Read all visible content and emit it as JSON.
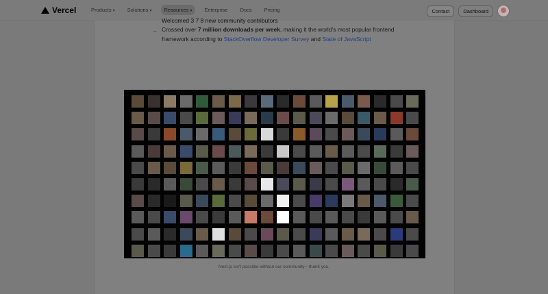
{
  "brand": {
    "name": "Vercel"
  },
  "nav": {
    "items": [
      {
        "label": "Products",
        "has_menu": true,
        "active": false
      },
      {
        "label": "Solutions",
        "has_menu": true,
        "active": false
      },
      {
        "label": "Resources",
        "has_menu": true,
        "active": true
      },
      {
        "label": "Enterprise",
        "has_menu": false,
        "active": false
      },
      {
        "label": "Docs",
        "has_menu": false,
        "active": false
      },
      {
        "label": "Pricing",
        "has_menu": false,
        "active": false
      }
    ],
    "contact_label": "Contact",
    "dashboard_label": "Dashboard"
  },
  "article": {
    "top_line": "Welcomed 3 7 8 new community contributors",
    "bullet_prefix": "Crossed over ",
    "bullet_bold": "7 million downloads per week",
    "bullet_mid": ", making it the world’s most popular frontend framework according to ",
    "link1": "StackOverflow Developer Survey",
    "and": " and ",
    "link2": "State of JavaScript"
  },
  "collage": {
    "tile_colors": [
      "#5a4a3a",
      "#3b3030",
      "#8a7a66",
      "#6b6b6b",
      "#2f5b3a",
      "#6a5a4a",
      "#7a6a4a",
      "#3a3a3a",
      "#5a6a7a",
      "#2a2a2a",
      "#6a4a3a",
      "#5a5a5a",
      "#b8a24a",
      "#4a5a6a",
      "#7a5a4a",
      "#2a2a2a",
      "#4a4a4a",
      "#6a6a5a",
      "#6a5a4a",
      "#5a4a4a",
      "#3a4a6a",
      "#4a4a4a",
      "#5a6a3a",
      "#6a5a5a",
      "#3a3a5a",
      "#7a6a5a",
      "#2a3a4a",
      "#6a4a4a",
      "#5a5a4a",
      "#4a4a5a",
      "#6a6a6a",
      "#5a4a3a",
      "#3a5a6a",
      "#6a5a4a",
      "#8a3a2a",
      "#4a4a4a",
      "#5a4a4a",
      "#3a3a3a",
      "#8a4a2a",
      "#4a5a6a",
      "#6a6a6a",
      "#3a5a7a",
      "#5a4a3a",
      "#6a6a3a",
      "#d8d8d8",
      "#3a3a3a",
      "#8a5a2a",
      "#5a4a5a",
      "#4a4a4a",
      "#6a5a5a",
      "#3a4a5a",
      "#2a3a5a",
      "#5a5a5a",
      "#6a4a3a",
      "#5a5a5a",
      "#4a3a3a",
      "#6a5a4a",
      "#3a4a6a",
      "#5a5a4a",
      "#6a4a4a",
      "#4a5a5a",
      "#7a6a5a",
      "#3a3a3a",
      "#c8c8c8",
      "#4a4a4a",
      "#5a5a5a",
      "#6a5a4a",
      "#5a5a5a",
      "#4a4a4a",
      "#5a6a5a",
      "#3a3a3a",
      "#6a5a5a",
      "#4a4a4a",
      "#6a5a4a",
      "#5a4a3a",
      "#7a6a3a",
      "#4a5a4a",
      "#5a5a5a",
      "#3a3a3a",
      "#6a4a3a",
      "#5a5a4a",
      "#4a3a3a",
      "#3a4a5a",
      "#6a5a5a",
      "#4a4a4a",
      "#5a5a4a",
      "#6a6a6a",
      "#3a4a3a",
      "#5a5a5a",
      "#4a4a4a",
      "#3a3a3a",
      "#2a2a2a",
      "#5a5a5a",
      "#3a4a3a",
      "#4a4a4a",
      "#6a5a4a",
      "#3a3a3a",
      "#5a4a4a",
      "#e8e8e8",
      "#4a4a5a",
      "#5a5a4a",
      "#3a3a4a",
      "#4a4a4a",
      "#7a5a7a",
      "#5a5a5a",
      "#4a4a4a",
      "#2a2a2a",
      "#4a5a4a",
      "#5a4a4a",
      "#2a2a2a",
      "#1a1a1a",
      "#5a5a4a",
      "#3a4a5a",
      "#5a6a3a",
      "#4a4a4a",
      "#5a4a3a",
      "#6a6a6a",
      "#f0f0f0",
      "#4a4a4a",
      "#4a3a6a",
      "#2a3a5a",
      "#7a7a7a",
      "#6a5a4a",
      "#4a5a6a",
      "#3a5a3a",
      "#4a4a4a",
      "#5a5a5a",
      "#4a4a4a",
      "#3a4a6a",
      "#6a4a6a",
      "#4a4a4a",
      "#3a3a3a",
      "#5a5a5a",
      "#c87a6a",
      "#6a4a3a",
      "#ffffff",
      "#5a5a5a",
      "#4a4a4a",
      "#5a5a5a",
      "#4a4a4a",
      "#3a3a3a",
      "#5a5a5a",
      "#4a4a4a",
      "#6a5a4a",
      "#4a4a4a",
      "#5a5a5a",
      "#2a2a2a",
      "#3a4a5a",
      "#6a5a4a",
      "#e0e0e0",
      "#5a4a3a",
      "#4a4a4a",
      "#6a4a5a",
      "#5a5a4a",
      "#4a4a4a",
      "#3a3a5a",
      "#5a5a5a",
      "#6a5a4a",
      "#7a6a5a",
      "#4a4a4a",
      "#2a3a7a",
      "#4a4a4a",
      "#5a5a4a",
      "#4a4a4a",
      "#3a3a3a",
      "#2a6a8a",
      "#5a5a5a",
      "#6a6a5a",
      "#4a4a4a",
      "#5a4a4a",
      "#3a3a3a",
      "#4a4a4a",
      "#5a5a5a",
      "#3a4a4a",
      "#4a4a4a",
      "#6a5a5a",
      "#4a4a4a",
      "#5a5a4a",
      "#3a3a3a",
      "#4a4a4a"
    ]
  },
  "caption": "Next.js isn't possible without our community—thank you."
}
